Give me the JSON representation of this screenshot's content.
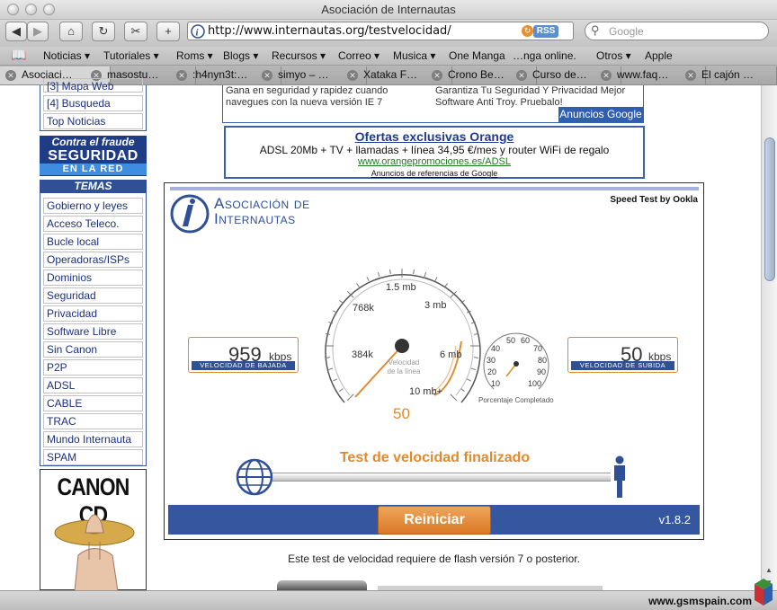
{
  "window": {
    "title": "Asociación de Internautas"
  },
  "toolbar": {
    "url": "http://www.internautas.org/testvelocidad/",
    "rss": "RSS",
    "search_placeholder": "Google"
  },
  "bookmarks": [
    "Noticias ▾",
    "Tutoriales ▾",
    "Roms ▾",
    "Blogs ▾",
    "Recursos ▾",
    "Correo ▾",
    "Musica ▾",
    "One Manga",
    "…nga online.",
    "Otros ▾",
    "Apple"
  ],
  "tabs": [
    "Asociaci…",
    "masostu…",
    ":h4nyn3t:…",
    "simyo – …",
    "Xataka F…",
    "Crono Be…",
    "Curso de…",
    "www.faq…",
    "El cajón …"
  ],
  "sidebar": {
    "top_items": [
      "[3] Mapa Web",
      "[4] Busqueda",
      "Top Noticias"
    ],
    "fraude": [
      "Contra el fraude",
      "SEGURIDAD",
      "EN LA RED"
    ],
    "temas_title": "TEMAS",
    "temas": [
      "Gobierno y leyes",
      "Acceso Teleco.",
      "Bucle local",
      "Operadoras/ISPs",
      "Dominios",
      "Seguridad",
      "Privacidad",
      "Software Libre",
      "Sin Canon",
      "P2P",
      "ADSL",
      "CABLE",
      "TRAC",
      "Mundo Internauta",
      "SPAM"
    ],
    "canon": "CANON CD"
  },
  "ad1": {
    "left": "Gana en seguridad y rapidez cuando navegues con la nueva versión IE 7",
    "right": "Garantiza Tu Seguridad Y Privacidad Mejor Software Anti Troy. Pruebalo!",
    "badge": "Anuncios Google"
  },
  "ad2": {
    "title": "Ofertas exclusivas Orange",
    "text": "ADSL 20Mb + TV + llamadas + línea 34,95 €/mes y router WiFi de regalo",
    "url": "www.orangepromociones.es/ADSL",
    "footer": "Anuncios de referencias de Google"
  },
  "speedtest": {
    "logo_top": "Asociación de",
    "logo_bottom": "Internautas",
    "brand": "Speed Test by Ookla",
    "download": {
      "value": "959",
      "unit": "kbps",
      "caption": "VELOCIDAD DE BAJADA"
    },
    "upload": {
      "value": "50",
      "unit": "kbps",
      "caption": "VELOCIDAD DE SUBIDA"
    },
    "gauge_labels": [
      "384k",
      "768k",
      "1.5 mb",
      "3 mb",
      "6 mb",
      "10 mb+"
    ],
    "gauge_center_label": [
      "Velocidad",
      "de la línea"
    ],
    "gauge_reading": "50",
    "pct_labels": [
      "10",
      "20",
      "30",
      "40",
      "50",
      "60",
      "70",
      "80",
      "90",
      "100"
    ],
    "pct_caption": "Porcentaje Completado",
    "status": "Test de velocidad finalizado",
    "restart": "Reiniciar",
    "version": "v1.8.2"
  },
  "footer_note": "Este test de velocidad requiere de flash versión 7 o posterior.",
  "watermark": "www.gsmspain.com",
  "colors": {
    "accent_orange": "#e08a2e",
    "nav_blue": "#2f4f96",
    "link_blue": "#1b2f80"
  }
}
